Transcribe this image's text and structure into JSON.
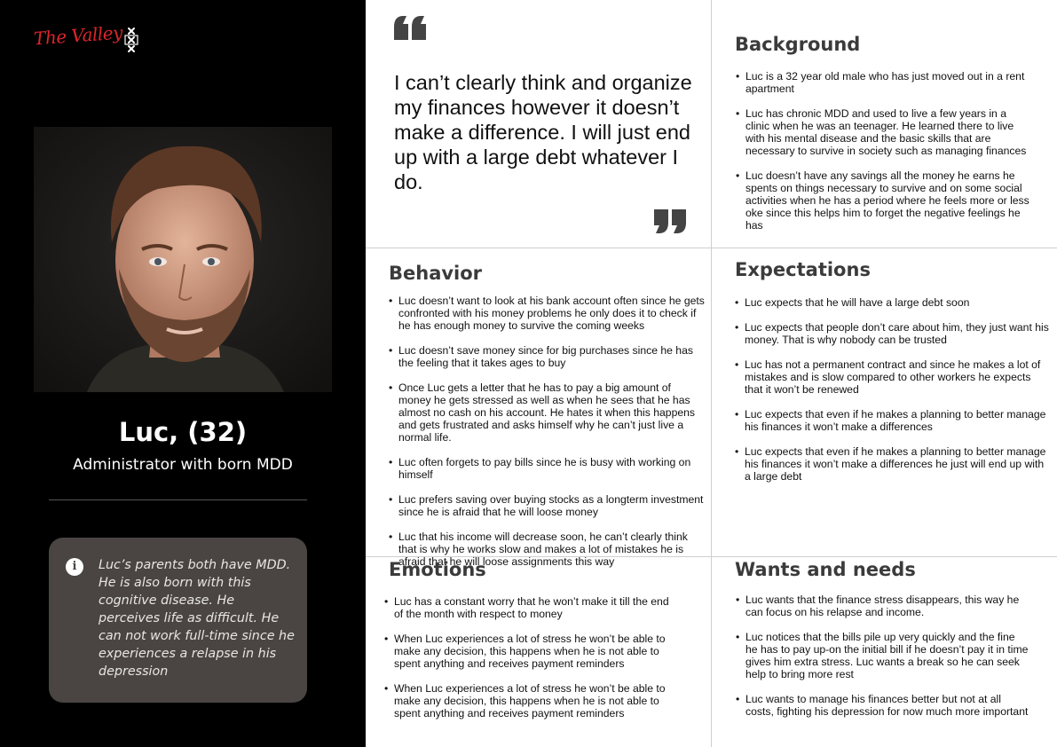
{
  "brand": {
    "valley_logo_text": "The Valley",
    "uva_logo": "uva-xxx-logo"
  },
  "persona": {
    "name": "Luc, (32)",
    "role": "Administrator with born MDD",
    "info": "Luc’s parents both have MDD. He is also born with this cognitive disease. He perceives life as difficult. He can not work full-time since he experiences a relapse in his depression"
  },
  "quote": {
    "text": "I can’t clearly think and organize my finances however it doesn’t make a difference. I will just end up with a large debt whatever I do."
  },
  "background": {
    "title": "Background",
    "items": [
      "Luc is a 32 year old male who has just moved out in a rent apartment",
      "Luc has chronic MDD and used to live a few years in a clinic when he was an teenager. He learned there to live with his mental disease and the basic skills that are necessary to survive in society such as managing finances",
      "Luc doesn’t have any savings all the money he earns he spents on things necessary to survive and on some social activities when he has a period where he feels more or less oke since this helps him to forget the negative feelings he has"
    ]
  },
  "behavior": {
    "title": "Behavior",
    "items": [
      "Luc doesn’t want to look at his bank account often since he gets confronted with his money problems he only does it to check if he has enough money to survive the coming weeks",
      "Luc doesn’t save money since for big purchases since he has the feeling that it takes ages to buy",
      "Once Luc gets a letter that he has to pay a big amount of money he gets stressed as well as when he sees that he has almost no cash on his account. He hates it when this happens and gets frustrated and asks himself why he can’t just live a normal life.",
      "Luc often forgets to pay bills since he is busy with working on himself",
      "Luc prefers saving over buying stocks as a longterm investment since he is afraid that he will loose money",
      "Luc that his income will decrease soon, he can’t clearly think that is why he works slow and makes a lot of mistakes he is afraid that he will loose assignments this way"
    ]
  },
  "expectations": {
    "title": "Expectations",
    "items": [
      "Luc expects that he will have a large debt soon",
      "Luc expects that people don’t care about him, they just want his money. That is why nobody can be trusted",
      "Luc has not a permanent contract and since he makes a lot of mistakes and is slow compared to other workers he expects that it won’t be renewed",
      "Luc expects that even if he makes a planning to better manage his finances it won’t make a differences",
      "Luc expects that even if he makes a planning to better manage his finances it won’t make a differences he just will end up with a large debt"
    ]
  },
  "emotions": {
    "title": "Emotions",
    "items": [
      "Luc has a constant worry that he won’t make it till the end of the month with respect to money",
      "When Luc experiences a lot of stress he won’t be able to make any decision, this happens when he is not able to spent anything  and receives payment reminders",
      "When Luc experiences a lot of stress he won’t be able to make any decision, this happens when he is not able to spent anything  and receives payment reminders"
    ]
  },
  "wants": {
    "title": "Wants and needs",
    "items": [
      "Luc wants that the finance stress disappears, this way he can focus on his relapse and income.",
      "Luc notices that the bills pile up very quickly and the fine he has to pay up-on the initial bill if he doesn’t pay it in time gives him extra stress. Luc wants a break so he can seek help to bring more rest",
      "Luc wants to manage his finances better but not at all costs, fighting his depression for now much more important"
    ]
  },
  "colors": {
    "sidebar": "#000000",
    "brand_red": "#d9262b",
    "infobox": "#4a4543",
    "title_gray": "#3b3b3b"
  }
}
